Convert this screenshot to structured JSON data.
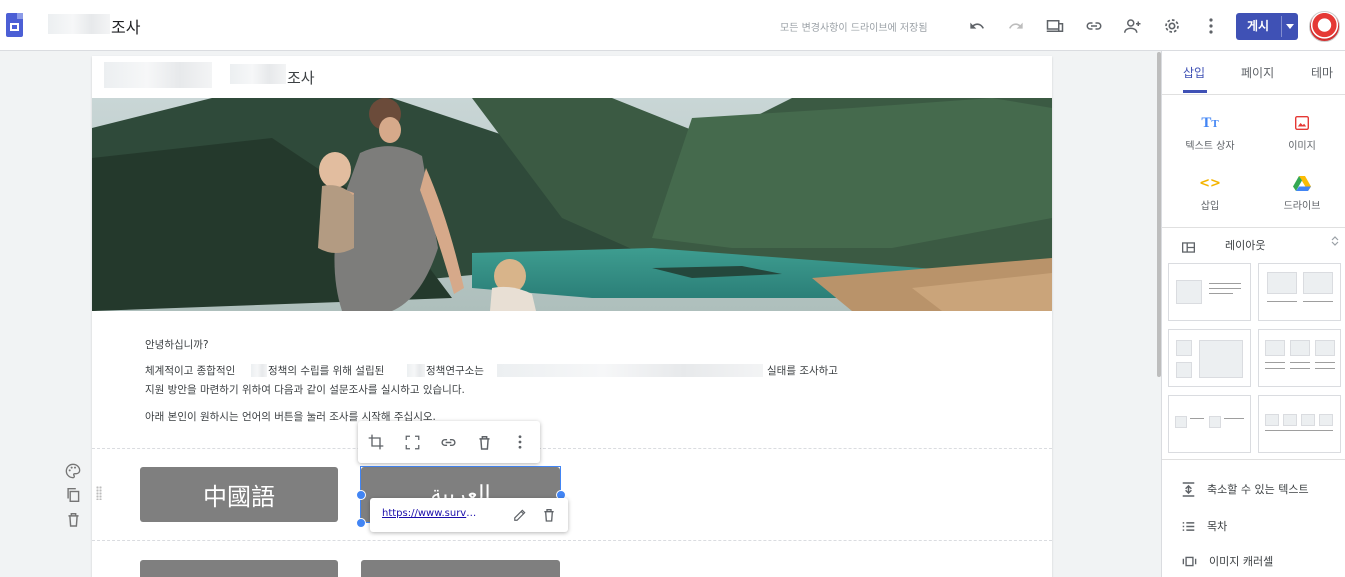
{
  "topbar": {
    "doc_title": "조사",
    "save_status": "모든 변경사항이 드라이브에 저장됨",
    "publish_label": "게시"
  },
  "site": {
    "title": "조사"
  },
  "intro": {
    "greeting": "안녕하십니까?",
    "line1_a": "체계적이고 종합적인",
    "line1_b": "정책의 수립를 위해 설립된",
    "line1_c": "정책연구소는",
    "line1_d": "실태를 조사하고",
    "line2": "지원 방안을 마련하기 위하여 다음과 같이 설문조사를 실시하고 있습니다.",
    "line3": "아래 본인이 원하시는 언어의 버튼을 눌러 조사를 시작해 주십시오."
  },
  "buttons": {
    "chinese": "中國語",
    "arabic": "العربية"
  },
  "link_popup": {
    "url": "https://www.surveymon..."
  },
  "panel": {
    "tabs": [
      "삽입",
      "페이지",
      "테마"
    ],
    "insert": {
      "text_box": "텍스트 상자",
      "image": "이미지",
      "embed": "삽입",
      "drive": "드라이브"
    },
    "layout_label": "레이아웃",
    "items": [
      "축소할 수 있는 텍스트",
      "목차",
      "이미지 캐러셀"
    ]
  },
  "colors": {
    "accent": "#3f51b5",
    "button_gray": "#7f7f7f",
    "selection": "#4285f4"
  }
}
